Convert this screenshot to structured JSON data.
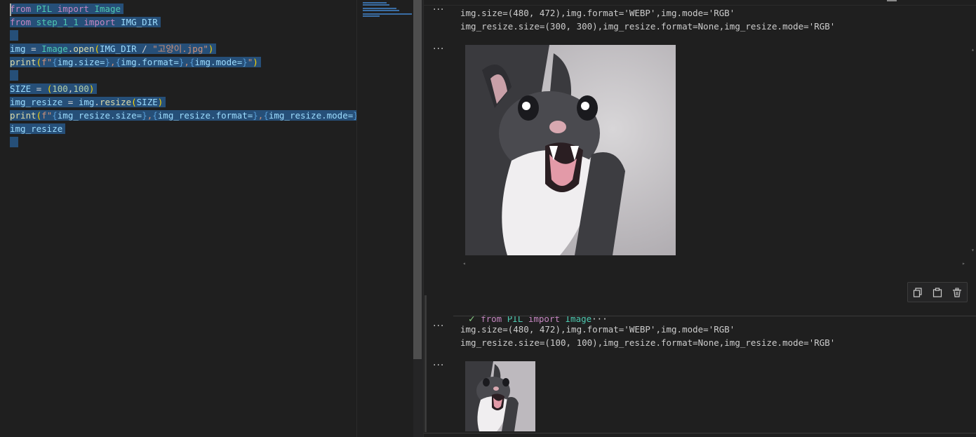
{
  "editor": {
    "lines": [
      [
        {
          "t": "from",
          "c": "kw"
        },
        {
          "t": " ",
          "c": "plain"
        },
        {
          "t": "PIL",
          "c": "mod"
        },
        {
          "t": " ",
          "c": "plain"
        },
        {
          "t": "import",
          "c": "kw"
        },
        {
          "t": " ",
          "c": "plain"
        },
        {
          "t": "Image",
          "c": "mod"
        }
      ],
      [
        {
          "t": "from",
          "c": "kw"
        },
        {
          "t": " ",
          "c": "plain"
        },
        {
          "t": "step_1_1",
          "c": "mod"
        },
        {
          "t": " ",
          "c": "plain"
        },
        {
          "t": "import",
          "c": "kw"
        },
        {
          "t": " ",
          "c": "plain"
        },
        {
          "t": "IMG_DIR",
          "c": "var"
        }
      ],
      [],
      [
        {
          "t": "img",
          "c": "var"
        },
        {
          "t": " = ",
          "c": "plain"
        },
        {
          "t": "Image",
          "c": "mod"
        },
        {
          "t": ".",
          "c": "plain"
        },
        {
          "t": "open",
          "c": "fn"
        },
        {
          "t": "(",
          "c": "paren"
        },
        {
          "t": "IMG_DIR",
          "c": "var"
        },
        {
          "t": " / ",
          "c": "plain"
        },
        {
          "t": "\"고양이.jpg\"",
          "c": "str"
        },
        {
          "t": ")",
          "c": "paren"
        }
      ],
      [
        {
          "t": "print",
          "c": "fn"
        },
        {
          "t": "(",
          "c": "paren"
        },
        {
          "t": "f\"",
          "c": "str"
        },
        {
          "t": "{",
          "c": "brace"
        },
        {
          "t": "img.size=",
          "c": "var"
        },
        {
          "t": "}",
          "c": "brace"
        },
        {
          "t": ",",
          "c": "str"
        },
        {
          "t": "{",
          "c": "brace"
        },
        {
          "t": "img.format=",
          "c": "var"
        },
        {
          "t": "}",
          "c": "brace"
        },
        {
          "t": ",",
          "c": "str"
        },
        {
          "t": "{",
          "c": "brace"
        },
        {
          "t": "img.mode=",
          "c": "var"
        },
        {
          "t": "}",
          "c": "brace"
        },
        {
          "t": "\"",
          "c": "str"
        },
        {
          "t": ")",
          "c": "paren"
        }
      ],
      [],
      [
        {
          "t": "SIZE",
          "c": "var"
        },
        {
          "t": " = ",
          "c": "plain"
        },
        {
          "t": "(",
          "c": "paren"
        },
        {
          "t": "100",
          "c": "num"
        },
        {
          "t": ",",
          "c": "plain"
        },
        {
          "t": "100",
          "c": "num"
        },
        {
          "t": ")",
          "c": "paren"
        }
      ],
      [
        {
          "t": "img_resize",
          "c": "var"
        },
        {
          "t": " = ",
          "c": "plain"
        },
        {
          "t": "img",
          "c": "var"
        },
        {
          "t": ".",
          "c": "plain"
        },
        {
          "t": "resize",
          "c": "fn"
        },
        {
          "t": "(",
          "c": "paren"
        },
        {
          "t": "SIZE",
          "c": "var"
        },
        {
          "t": ")",
          "c": "paren"
        }
      ],
      [
        {
          "t": "print",
          "c": "fn"
        },
        {
          "t": "(",
          "c": "paren"
        },
        {
          "t": "f\"",
          "c": "str"
        },
        {
          "t": "{",
          "c": "brace"
        },
        {
          "t": "img_resize.size=",
          "c": "var"
        },
        {
          "t": "}",
          "c": "brace"
        },
        {
          "t": ",",
          "c": "str"
        },
        {
          "t": "{",
          "c": "brace"
        },
        {
          "t": "img_resize.format=",
          "c": "var"
        },
        {
          "t": "}",
          "c": "brace"
        },
        {
          "t": ",",
          "c": "str"
        },
        {
          "t": "{",
          "c": "brace"
        },
        {
          "t": "img_resize.mode=",
          "c": "var"
        },
        {
          "t": "}",
          "c": "brace"
        },
        {
          "t": "\"",
          "c": "str"
        },
        {
          "t": ")",
          "c": "paren"
        }
      ],
      [
        {
          "t": "img_resize",
          "c": "var"
        }
      ],
      []
    ]
  },
  "outputs": {
    "top_text_1": "img.size=(480, 472),img.format='WEBP',img.mode='RGB'",
    "top_text_2": "img_resize.size=(300, 300),img_resize.format=None,img_resize.mode='RGB'",
    "bottom_text_1": "img.size=(480, 472),img.format='WEBP',img.mode='RGB'",
    "bottom_text_2": "img_resize.size=(100, 100),img_resize.format=None,img_resize.mode='RGB'",
    "more_glyph": "···"
  },
  "cell": {
    "header_kw1": "from",
    "header_mod": "PIL",
    "header_kw2": "import",
    "header_mod2": "Image",
    "header_ellipsis": "···",
    "check_glyph": "✓"
  },
  "icons": {
    "copy": "copy-icon",
    "paste": "paste-icon",
    "delete": "trash-icon",
    "success": "check-icon"
  },
  "colors": {
    "selection": "#264f78",
    "keyword": "#c586c0",
    "module": "#4ec9b0",
    "variable": "#9cdcfe",
    "string": "#ce9178",
    "check": "#89d185"
  }
}
